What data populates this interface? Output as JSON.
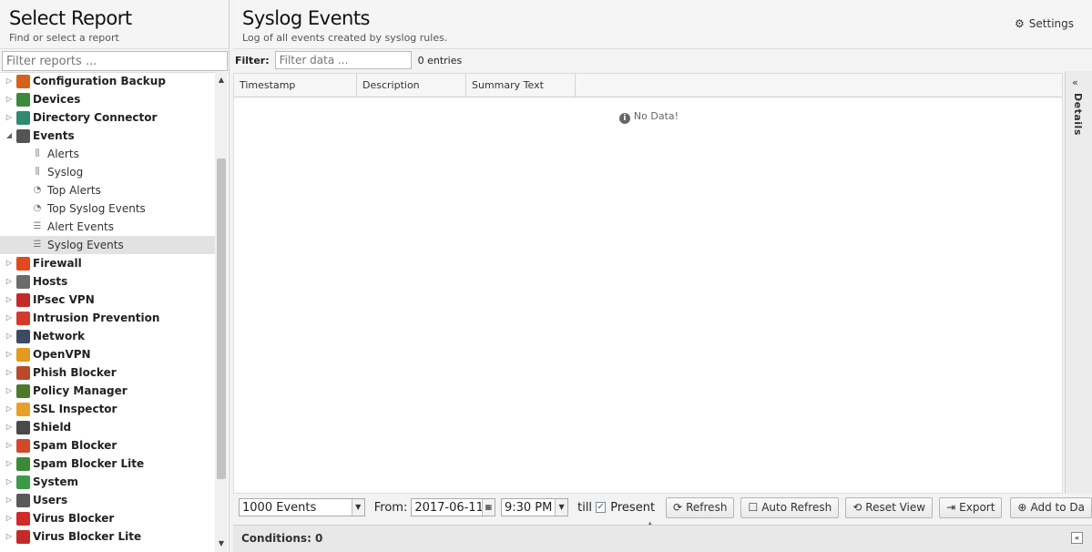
{
  "left": {
    "title": "Select Report",
    "subtitle": "Find or select a report",
    "filter_placeholder": "Filter reports ..."
  },
  "tree": {
    "apps": [
      {
        "label": "Configuration Backup",
        "color": "#d4621c",
        "icon": "backup-icon"
      },
      {
        "label": "Devices",
        "color": "#3d8a3d",
        "icon": "devices-icon"
      },
      {
        "label": "Directory Connector",
        "color": "#2f8a6f",
        "icon": "directory-icon"
      },
      {
        "label": "Events",
        "color": "#555555",
        "icon": "events-icon",
        "expanded": true
      }
    ],
    "events_children": [
      {
        "label": "Alerts",
        "icon": "bar-chart-icon",
        "glyph": "📊"
      },
      {
        "label": "Syslog",
        "icon": "bar-chart-icon",
        "glyph": "📊"
      },
      {
        "label": "Top Alerts",
        "icon": "pie-chart-icon",
        "glyph": "◔"
      },
      {
        "label": "Top Syslog Events",
        "icon": "pie-chart-icon",
        "glyph": "◔"
      },
      {
        "label": "Alert Events",
        "icon": "list-icon",
        "glyph": "☰"
      },
      {
        "label": "Syslog Events",
        "icon": "list-icon",
        "glyph": "☰",
        "selected": true
      }
    ],
    "apps_after": [
      {
        "label": "Firewall",
        "color": "#e04a1e",
        "icon": "firewall-icon"
      },
      {
        "label": "Hosts",
        "color": "#6b6b6b",
        "icon": "hosts-icon"
      },
      {
        "label": "IPsec VPN",
        "color": "#c42a2a",
        "icon": "lock-icon"
      },
      {
        "label": "Intrusion Prevention",
        "color": "#d23c2c",
        "icon": "ips-icon"
      },
      {
        "label": "Network",
        "color": "#3c4b63",
        "icon": "network-icon"
      },
      {
        "label": "OpenVPN",
        "color": "#e49a1c",
        "icon": "openvpn-icon"
      },
      {
        "label": "Phish Blocker",
        "color": "#b84a2a",
        "icon": "phish-icon"
      },
      {
        "label": "Policy Manager",
        "color": "#4a7a2a",
        "icon": "policy-icon"
      },
      {
        "label": "SSL Inspector",
        "color": "#e8a02a",
        "icon": "ssl-icon"
      },
      {
        "label": "Shield",
        "color": "#4a4a4a",
        "icon": "shield-icon"
      },
      {
        "label": "Spam Blocker",
        "color": "#d04a2a",
        "icon": "spam-icon"
      },
      {
        "label": "Spam Blocker Lite",
        "color": "#3a8a3a",
        "icon": "spam-lite-icon"
      },
      {
        "label": "System",
        "color": "#3a9a4a",
        "icon": "system-icon"
      },
      {
        "label": "Users",
        "color": "#5a5a5a",
        "icon": "users-icon"
      },
      {
        "label": "Virus Blocker",
        "color": "#d22a2a",
        "icon": "virus-icon"
      },
      {
        "label": "Virus Blocker Lite",
        "color": "#c42a2a",
        "icon": "virus-lite-icon"
      }
    ]
  },
  "right": {
    "title": "Syslog Events",
    "subtitle": "Log of all events created by syslog rules.",
    "settings_label": "Settings",
    "filter_label": "Filter:",
    "filter_placeholder": "Filter data ...",
    "entries": "0 entries",
    "columns": [
      "Timestamp",
      "Description",
      "Summary Text"
    ],
    "no_data": "No Data!",
    "details_label": "Details"
  },
  "toolbar": {
    "events_limit": "1000 Events",
    "from_label": "From:",
    "from_date": "2017-06-11",
    "from_time": "9:30 PM",
    "till_label": "till",
    "present_label": "Present",
    "refresh": "Refresh",
    "auto_refresh": "Auto Refresh",
    "reset_view": "Reset View",
    "export": "Export",
    "add_to": "Add to Da"
  },
  "conditions_label": "Conditions: 0"
}
